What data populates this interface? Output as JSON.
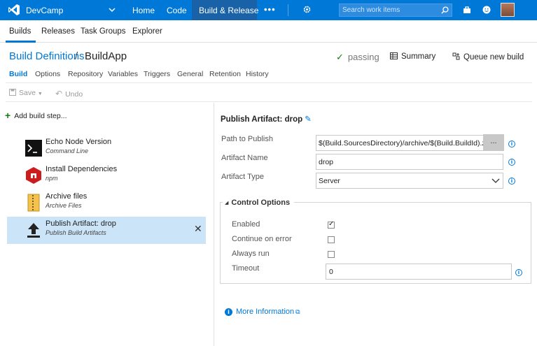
{
  "topbar": {
    "project": "DevCamp",
    "nav": [
      "Home",
      "Code",
      "Build & Release"
    ],
    "more": "•••",
    "search_placeholder": "Search work items"
  },
  "subnav": {
    "items": [
      "Builds",
      "Releases",
      "Task Groups",
      "Explorer"
    ],
    "active": "Builds"
  },
  "header": {
    "breadcrumb_link": "Build Definitions",
    "separator": "/",
    "title": "BuildApp",
    "status": "passing",
    "summary": "Summary",
    "queue": "Queue new build"
  },
  "tabs": [
    "Build",
    "Options",
    "Repository",
    "Variables",
    "Triggers",
    "General",
    "Retention",
    "History"
  ],
  "toolbar": {
    "save": "Save",
    "undo": "Undo"
  },
  "steps": {
    "add_label": "Add build step...",
    "items": [
      {
        "name": "Echo Node Version",
        "sub": "Command Line",
        "icon": "command-line-icon"
      },
      {
        "name": "Install Dependencies",
        "sub": "npm",
        "icon": "npm-icon"
      },
      {
        "name": "Archive files",
        "sub": "Archive Files",
        "icon": "archive-icon"
      },
      {
        "name": "Publish Artifact: drop",
        "sub": "Publish Build Artifacts",
        "icon": "upload-icon",
        "selected": true
      }
    ]
  },
  "detail": {
    "title": "Publish Artifact: drop",
    "path_label": "Path to Publish",
    "path_value": "$(Build.SourcesDirectory)/archive/$(Build.BuildId).zip",
    "browse": "...",
    "name_label": "Artifact Name",
    "name_value": "drop",
    "type_label": "Artifact Type",
    "type_value": "Server",
    "control_options": "Control Options",
    "enabled_label": "Enabled",
    "enabled": true,
    "continue_label": "Continue on error",
    "continue": false,
    "always_label": "Always run",
    "always": false,
    "timeout_label": "Timeout",
    "timeout_value": "0",
    "more_info": "More Information"
  },
  "colors": {
    "accent": "#0078d7",
    "success": "#107c10",
    "selected_row": "#cce4f7"
  }
}
